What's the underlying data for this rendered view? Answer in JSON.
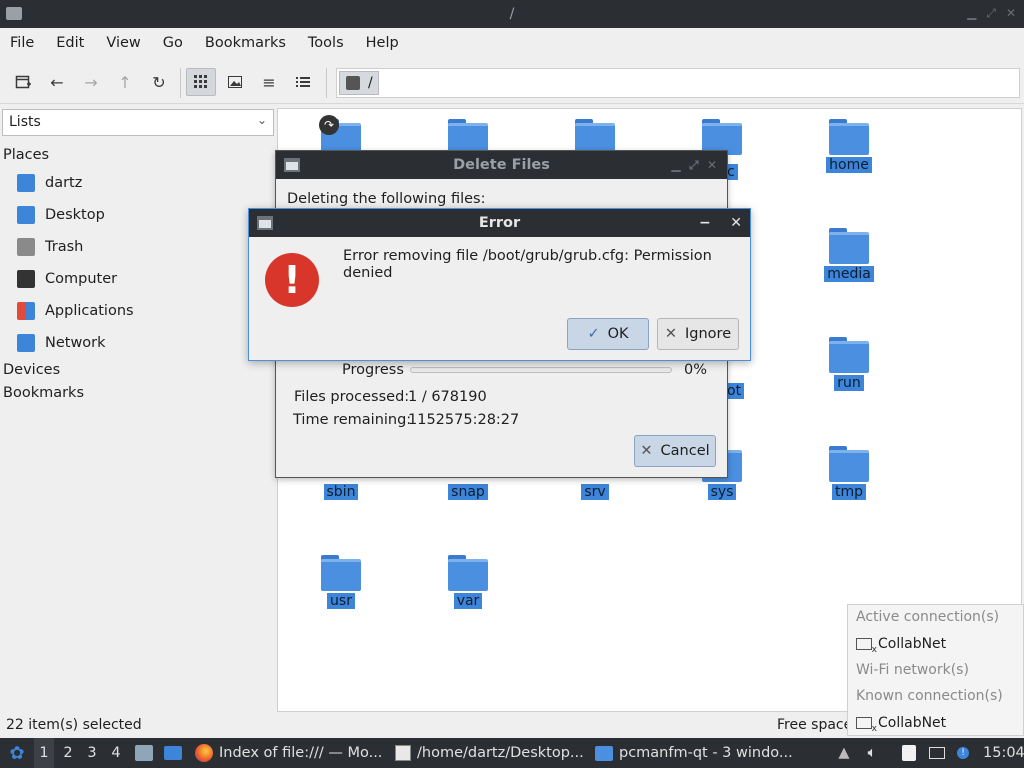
{
  "window": {
    "title": "/"
  },
  "menu": [
    "File",
    "Edit",
    "View",
    "Go",
    "Bookmarks",
    "Tools",
    "Help"
  ],
  "toolbar": {
    "path": "/"
  },
  "sidebar": {
    "selector": "Lists",
    "places_heading": "Places",
    "places": [
      {
        "label": "dartz",
        "icon": "home-folder-icon",
        "color": "#3d85d8"
      },
      {
        "label": "Desktop",
        "icon": "desktop-icon",
        "color": "#3d85d8"
      },
      {
        "label": "Trash",
        "icon": "trash-icon",
        "color": "#8a8a8a"
      },
      {
        "label": "Computer",
        "icon": "computer-icon",
        "color": "#333333"
      },
      {
        "label": "Applications",
        "icon": "applications-icon",
        "color": "#e8a33a"
      },
      {
        "label": "Network",
        "icon": "network-icon",
        "color": "#3d85d8"
      }
    ],
    "devices_heading": "Devices",
    "bookmarks_heading": "Bookmarks"
  },
  "files": [
    "home",
    "media",
    "run",
    "sbin",
    "snap",
    "srv",
    "sys",
    "tmp",
    "usr",
    "var"
  ],
  "partial_labels": {
    "etc_tail": "c",
    "root_tail": "ot"
  },
  "status": {
    "left": "22 item(s) selected",
    "right": "Free space"
  },
  "delete_dialog": {
    "title": "Delete Files",
    "heading": "Deleting the following files:",
    "progress_label": "Progress",
    "progress_percent": "0%",
    "progress_fraction": 0.0,
    "files_processed_label": "Files processed:",
    "files_processed_value": "1 / 678190",
    "time_remaining_label": "Time remaining:",
    "time_remaining_value": "1152575:28:27",
    "cancel_label": "Cancel"
  },
  "error_dialog": {
    "title": "Error",
    "message_line1": "Error removing file /boot/grub/grub.cfg: Permission",
    "message_line2": "denied",
    "ok_label": "OK",
    "ignore_label": "Ignore"
  },
  "network_popup": {
    "active_heading": "Active connection(s)",
    "active_item": "CollabNet",
    "wifi_heading": "Wi-Fi network(s)",
    "known_heading": "Known connection(s)",
    "known_item": "CollabNet"
  },
  "taskbar": {
    "workspaces": [
      "1",
      "2",
      "3",
      "4"
    ],
    "tasks": [
      {
        "label": "Index of file:/// — Mo..."
      },
      {
        "label": "/home/dartz/Desktop..."
      },
      {
        "label": "pcmanfm-qt - 3 windo..."
      }
    ],
    "clock": "15:04"
  }
}
